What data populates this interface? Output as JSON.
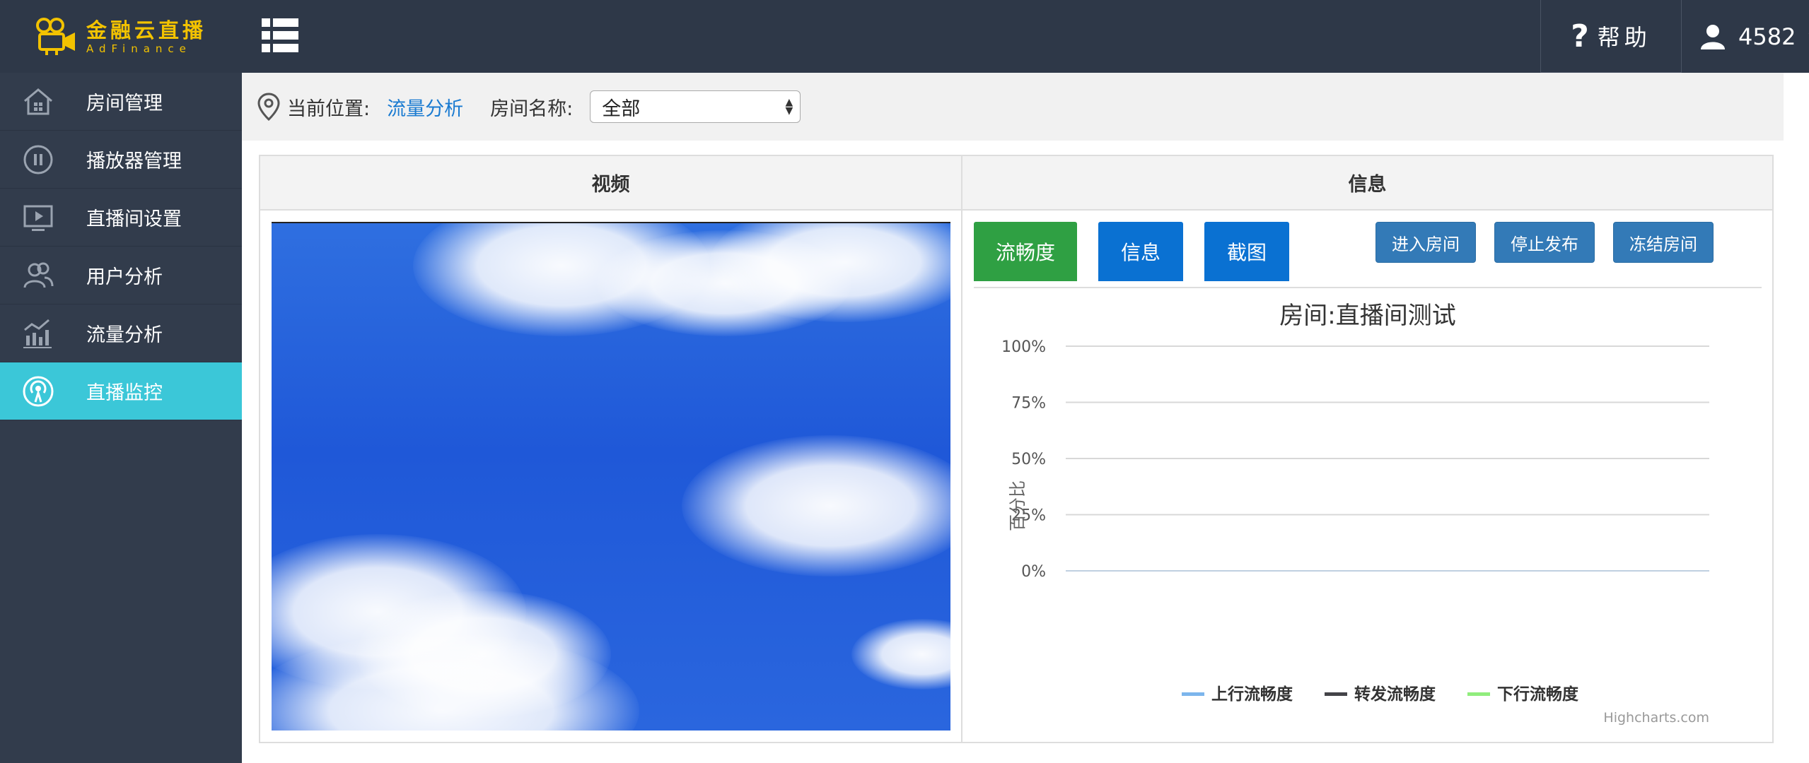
{
  "logo": {
    "cn": "金融云直播",
    "en": "AdFinance",
    "color": "#f2c200"
  },
  "sidebar": {
    "items": [
      {
        "label": "房间管理",
        "icon": "house-icon",
        "active": false
      },
      {
        "label": "播放器管理",
        "icon": "pause-circle-icon",
        "active": false
      },
      {
        "label": "直播间设置",
        "icon": "monitor-play-icon",
        "active": false
      },
      {
        "label": "用户分析",
        "icon": "users-icon",
        "active": false
      },
      {
        "label": "流量分析",
        "icon": "bar-chart-icon",
        "active": false
      },
      {
        "label": "直播监控",
        "icon": "broadcast-icon",
        "active": true
      }
    ],
    "active_color": "#3bc7d8"
  },
  "topbar": {
    "help_symbol": "?",
    "help_label": "帮助",
    "username": "4582"
  },
  "breadcrumb": {
    "prefix": "当前位置:",
    "current": "流量分析",
    "room_label": "房间名称:",
    "room_selected": "全部"
  },
  "table": {
    "headers": {
      "video": "视频",
      "info": "信息"
    }
  },
  "tabs": [
    {
      "label": "流畅度",
      "color": "#2fa043"
    },
    {
      "label": "信息",
      "color": "#0a71d2"
    },
    {
      "label": "截图",
      "color": "#0a71d2"
    }
  ],
  "actions": [
    {
      "label": "进入房间"
    },
    {
      "label": "停止发布"
    },
    {
      "label": "冻结房间"
    }
  ],
  "chart_data": {
    "type": "line",
    "title": "房间:直播间测试",
    "ylabel": "百分比",
    "xlabel": "",
    "ylim": [
      0,
      100
    ],
    "yticks": [
      "100%",
      "75%",
      "50%",
      "25%",
      "0%"
    ],
    "series": [
      {
        "name": "上行流畅度",
        "color": "#7cb5ec",
        "values": []
      },
      {
        "name": "转发流畅度",
        "color": "#434348",
        "values": []
      },
      {
        "name": "下行流畅度",
        "color": "#90ed7d",
        "values": []
      }
    ],
    "legend": "bottom-center",
    "credits": "Highcharts.com"
  }
}
